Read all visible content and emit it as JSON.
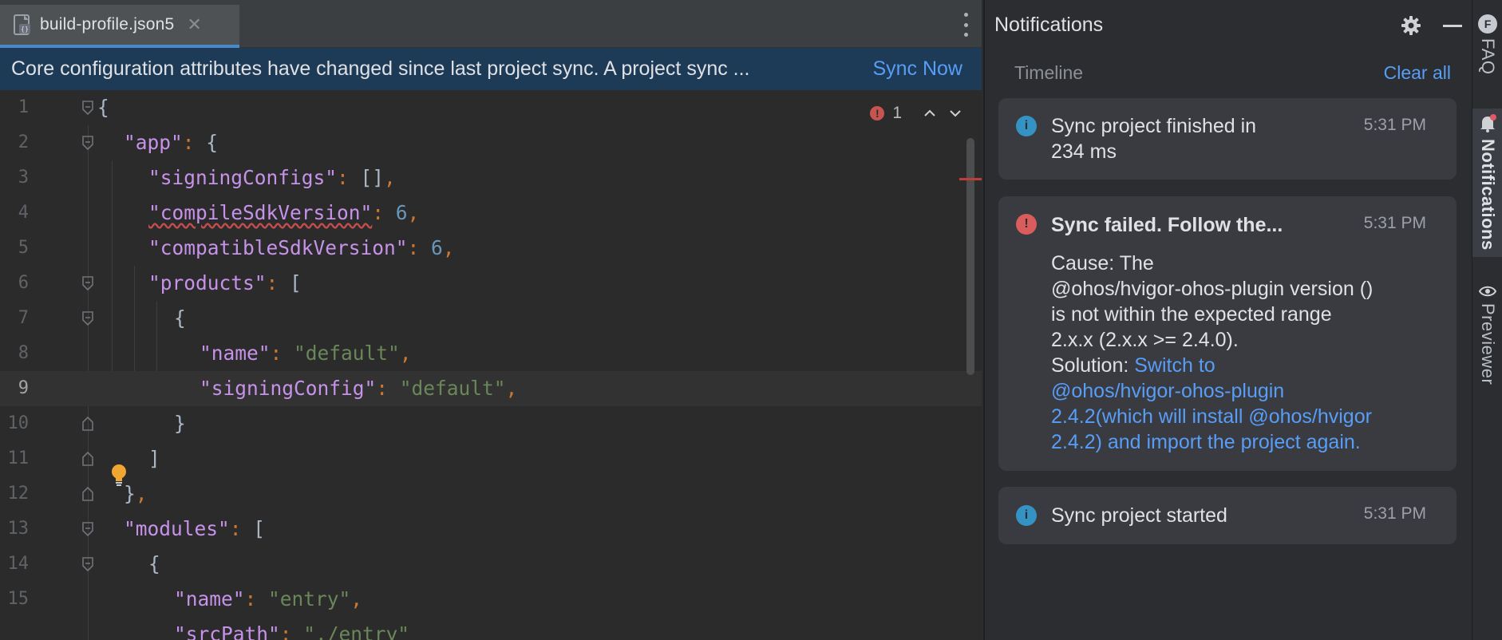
{
  "editor": {
    "tab": {
      "label": "build-profile.json5",
      "close": "✕",
      "icon": "json5-file-icon"
    },
    "banner": {
      "text": "Core configuration attributes have changed since last project sync. A project sync ...",
      "action": "Sync Now"
    },
    "error_indicator": {
      "count": "1"
    },
    "lines": [
      {
        "num": "1"
      },
      {
        "num": "2"
      },
      {
        "num": "3"
      },
      {
        "num": "4"
      },
      {
        "num": "5"
      },
      {
        "num": "6"
      },
      {
        "num": "7"
      },
      {
        "num": "8"
      },
      {
        "num": "9"
      },
      {
        "num": "10"
      },
      {
        "num": "11"
      },
      {
        "num": "12"
      },
      {
        "num": "13"
      },
      {
        "num": "14"
      },
      {
        "num": "15"
      }
    ],
    "code": {
      "l1_open": "{",
      "l2_key": "\"app\"",
      "l2_rest": " {",
      "l3_key": "\"signingConfigs\"",
      "l3_val": "[]",
      "l4_key": "\"compileSdkVersion\"",
      "l4_val": "6",
      "l5_key": "\"compatibleSdkVersion\"",
      "l5_val": "6",
      "l6_key": "\"products\"",
      "l6_rest": " [",
      "l7_open": "{",
      "l8_key": "\"name\"",
      "l8_val": "\"default\"",
      "l9_key": "\"signingConfig\"",
      "l9_val": "\"default\"",
      "l10_close": "}",
      "l11_close": "]",
      "l12_close": "}",
      "l13_key": "\"modules\"",
      "l13_rest": " [",
      "l14_open": "{",
      "l15_key": "\"name\"",
      "l15_val": "\"entry\"",
      "l16_key": "\"srcPath\"",
      "l16_val": "\"./entry\""
    },
    "current_line": "9"
  },
  "notifications": {
    "title": "Notifications",
    "timeline_label": "Timeline",
    "clear_all": "Clear all",
    "items": [
      {
        "type": "info",
        "title_line1": "Sync project finished in",
        "title_line2": "234 ms",
        "time": "5:31 PM"
      },
      {
        "type": "error",
        "title": "Sync failed. Follow the...",
        "time": "5:31 PM",
        "body_line1": "Cause: The",
        "body_line2": "@ohos/hvigor-ohos-plugin version ()",
        "body_line3": "is not within the expected range",
        "body_line4": "2.x.x (2.x.x >= 2.4.0).",
        "solution_label": "Solution: ",
        "link_line1": "Switch to",
        "link_line2": "@ohos/hvigor-ohos-plugin",
        "link_line3": "2.4.2(which will install @ohos/hvigor",
        "link_line4": "2.4.2) and import the project again."
      },
      {
        "type": "info",
        "title": "Sync project started",
        "time": "5:31 PM"
      }
    ]
  },
  "tool_strip": {
    "faq": "FAQ",
    "faq_icon_letter": "F",
    "notifications": "Notifications",
    "previewer": "Previewer"
  },
  "colors": {
    "accent_link": "#589df6",
    "banner_bg": "#1d3a56",
    "error": "#db5c5c",
    "info": "#3592c4"
  }
}
